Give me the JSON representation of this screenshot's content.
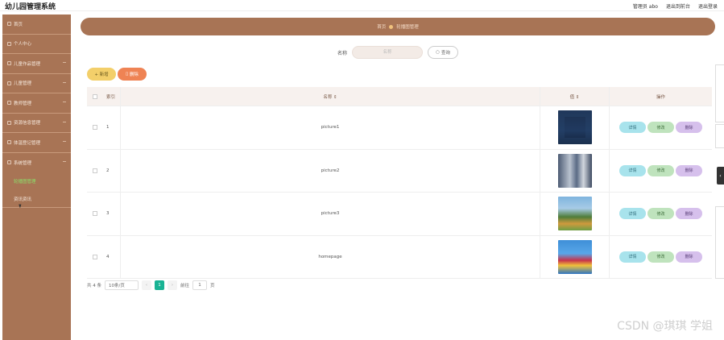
{
  "header": {
    "app_title": "幼儿园管理系统",
    "links": [
      "管理员 abo",
      "退出到前台",
      "退出登录"
    ]
  },
  "sidebar": {
    "items": [
      {
        "label": "首页",
        "icon": "home-icon"
      },
      {
        "label": "个人中心",
        "icon": "user-icon"
      },
      {
        "label": "儿童作品管理",
        "icon": "folder-icon"
      },
      {
        "label": "儿童管理",
        "icon": "folder-icon"
      },
      {
        "label": "教师管理",
        "icon": "folder-icon"
      },
      {
        "label": "资源信息管理",
        "icon": "folder-icon"
      },
      {
        "label": "体温登记管理",
        "icon": "folder-icon"
      },
      {
        "label": "系统管理",
        "icon": "settings-icon"
      }
    ],
    "subitems": [
      {
        "label": "轮播图管理",
        "active": true
      },
      {
        "label": "资讯资讯",
        "active": false
      }
    ]
  },
  "breadcrumb": {
    "home": "首页",
    "current": "轮播图管理"
  },
  "search": {
    "label": "名称",
    "placeholder": "名称",
    "button": "查询"
  },
  "actions": {
    "add": "+ 新增",
    "delete": "删除"
  },
  "table": {
    "headers": {
      "index": "索引",
      "name": "名称 ⇕",
      "value": "值 ⇕",
      "ops": "操作"
    },
    "rows": [
      {
        "index": "1",
        "name": "picture1"
      },
      {
        "index": "2",
        "name": "picture2"
      },
      {
        "index": "3",
        "name": "picture3"
      },
      {
        "index": "4",
        "name": "homepage"
      }
    ],
    "op_labels": {
      "detail": "详情",
      "edit": "修改",
      "delete": "删除"
    }
  },
  "pager": {
    "total": "共 4 条",
    "page_size": "10条/页",
    "prev": "‹",
    "current": "1",
    "next": "›",
    "goto": "前往",
    "goto_value": "1",
    "page_unit": "页"
  },
  "watermark": "CSDN @琪琪 学姐",
  "colors": {
    "sidebar": "#a87455",
    "accent": "#19b394",
    "add_button": "#f3cf6a",
    "delete_button": "#ef8354"
  }
}
